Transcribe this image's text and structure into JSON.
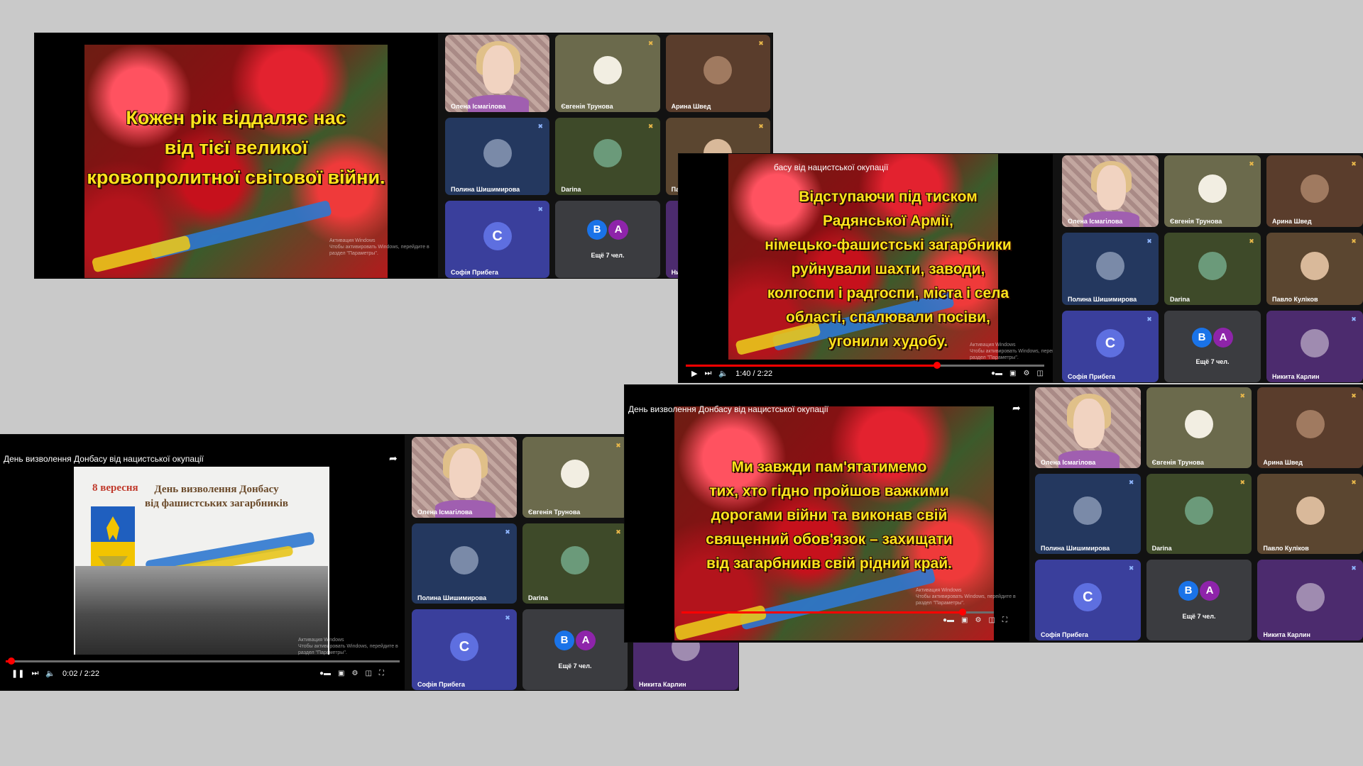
{
  "video_titles": {
    "main": "День визволення Донбасу від нацистської окупації",
    "partial": "басу від нацистської окупації"
  },
  "subtitles": {
    "s1": [
      "Кожен рік віддаляє нас",
      "від тієї великої",
      "кровопролитної світової війни."
    ],
    "s2": [
      "Відступаючи під тиском",
      "Радянської Армії,",
      "німецько-фашистські загарбники",
      "руйнували шахти, заводи,",
      "колгоспи і радгоспи, міста і села",
      "області, спалювали посіви,",
      "угонили худобу."
    ],
    "s3": [
      "Ми завжди пам'ятатимемо",
      "тих, хто гідно пройшов важкими",
      "дорогами війни та виконав свій",
      "священний обов'язок – захищати",
      "від загарбників свій рідний край."
    ],
    "s4_date": "8 вересня",
    "s4_title": [
      "День визволення Донбасу",
      "від фашистських загарбників"
    ]
  },
  "player": {
    "time_a": "1:40 / 2:22",
    "time_b": "0:02 / 2:22",
    "progress_a": 0.7,
    "progress_b": 0.015,
    "progress_c": 0.9
  },
  "watermark": [
    "Активация Windows",
    "Чтобы активировать Windows, перейдите в",
    "раздел \"Параметры\"."
  ],
  "participants": [
    {
      "name": "Олена Ісмагілова",
      "type": "selfie",
      "mic": ""
    },
    {
      "name": "Євгенія Трунова",
      "type": "avatar",
      "bg": "#6b6a4c",
      "av": "#f2eee2",
      "mic": "muted-yellow"
    },
    {
      "name": "Арина Швед",
      "type": "avatar",
      "bg": "#5a3d2c",
      "av": "#a07a60",
      "mic": "muted-yellow"
    },
    {
      "name": "Полина Шишимирова",
      "type": "avatar",
      "bg": "#24385f",
      "av": "#7a8aa8",
      "mic": "muted-blue"
    },
    {
      "name": "Darina",
      "type": "avatar",
      "bg": "#3e4a29",
      "av": "#6b9a7a",
      "mic": "muted-yellow"
    },
    {
      "name": "Павло Кулiков",
      "type": "avatar",
      "bg": "#5b4630",
      "av": "#d9b99a",
      "mic": "muted-yellow"
    },
    {
      "name": "Софія Прибега",
      "type": "letter",
      "bg": "#3a3f9c",
      "letter": "C",
      "mic": "muted-blue"
    },
    {
      "name": "Ещё 7 чел.",
      "type": "more",
      "bg": "#3b3c40",
      "letters": [
        "B",
        "A"
      ],
      "colors": [
        "#1a73e8",
        "#8e24aa"
      ]
    },
    {
      "name": "Никита Карлин",
      "type": "avatar",
      "bg": "#4c2b6e",
      "av": "#9f8bb0",
      "mic": "muted-blue"
    }
  ]
}
